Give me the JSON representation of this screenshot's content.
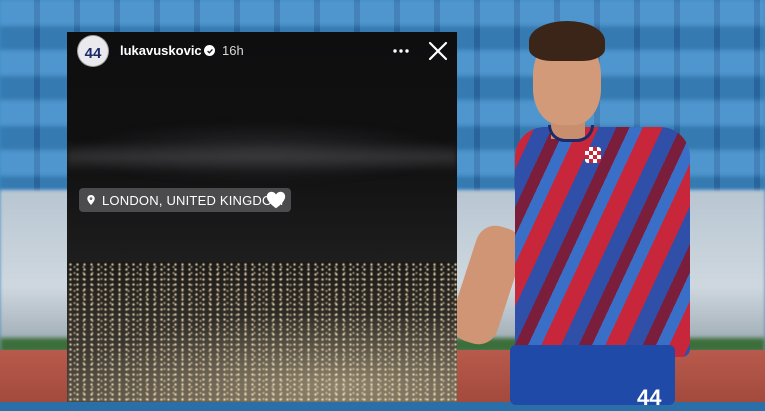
{
  "story": {
    "avatar_text": "44",
    "username": "lukavuskovic",
    "time": "16h",
    "location": "LONDON, UNITED KINGDOM"
  },
  "player": {
    "shorts_number": "44"
  },
  "colors": {
    "story_bg": "#111112",
    "sticker_bg": "#78787d",
    "jersey_red": "#c8263a",
    "jersey_blue": "#2f4fa8",
    "stadium_blue": "#3d8bc9"
  },
  "icons": [
    "verified-icon",
    "more-icon",
    "close-icon",
    "location-pin-icon",
    "heart-icon"
  ]
}
